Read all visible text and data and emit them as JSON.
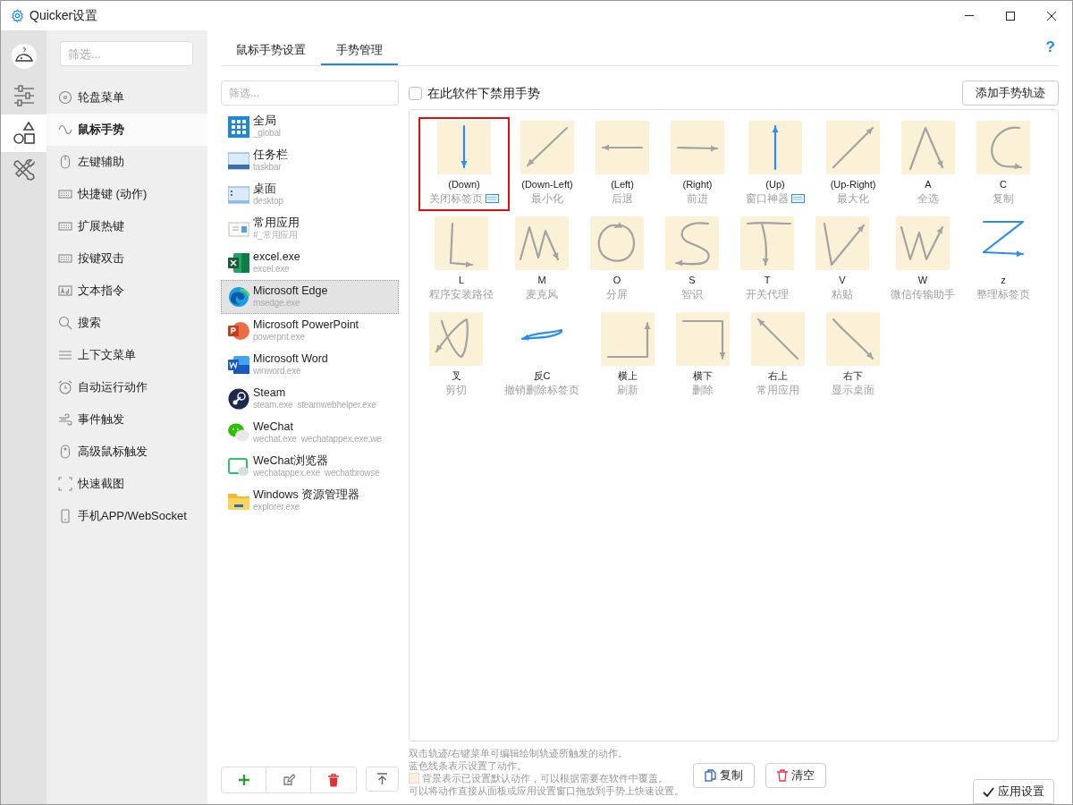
{
  "window": {
    "title": "Quicker设置"
  },
  "rail": [
    {
      "selected": false
    },
    {
      "selected": false
    },
    {
      "selected": true
    },
    {
      "selected": false
    }
  ],
  "nav": {
    "filter_placeholder": "筛选...",
    "items": [
      {
        "label": "轮盘菜单",
        "selected": false
      },
      {
        "label": "鼠标手势",
        "selected": true
      },
      {
        "label": "左键辅助",
        "selected": false
      },
      {
        "label": "快捷键 (动作)",
        "selected": false
      },
      {
        "label": "扩展热键",
        "selected": false
      },
      {
        "label": "按键双击",
        "selected": false
      },
      {
        "label": "文本指令",
        "selected": false
      },
      {
        "label": "搜索",
        "selected": false
      },
      {
        "label": "上下文菜单",
        "selected": false
      },
      {
        "label": "自动运行动作",
        "selected": false
      },
      {
        "label": "事件触发",
        "selected": false
      },
      {
        "label": "高级鼠标触发",
        "selected": false
      },
      {
        "label": "快速截图",
        "selected": false
      },
      {
        "label": "手机APP/WebSocket",
        "selected": false
      }
    ]
  },
  "tabs": [
    {
      "label": "鼠标手势设置",
      "selected": false
    },
    {
      "label": "手势管理",
      "selected": true
    }
  ],
  "help": "?",
  "apps": {
    "filter_placeholder": "筛选...",
    "items": [
      {
        "name": "全局",
        "exe": "_global",
        "selected": false
      },
      {
        "name": "任务栏",
        "exe": "taskbar",
        "selected": false
      },
      {
        "name": "桌面",
        "exe": "desktop",
        "selected": false
      },
      {
        "name": "常用应用",
        "exe": "#_常用应用",
        "selected": false
      },
      {
        "name": "excel.exe",
        "exe": "excel.exe",
        "selected": false
      },
      {
        "name": "Microsoft Edge",
        "exe": "msedge.exe",
        "selected": true
      },
      {
        "name": "Microsoft PowerPoint",
        "exe": "powerpnt.exe",
        "selected": false
      },
      {
        "name": "Microsoft Word",
        "exe": "winword.exe",
        "selected": false
      },
      {
        "name": "Steam",
        "exe": "steam.exe  steamwebhelper.exe",
        "selected": false
      },
      {
        "name": "WeChat",
        "exe": "wechat.exe  wechatappex.exe;we",
        "selected": false
      },
      {
        "name": "WeChat浏览器",
        "exe": "wechatappex.exe  wechatbrowse",
        "selected": false
      },
      {
        "name": "Windows 资源管理器",
        "exe": "explorer.exe",
        "selected": false
      }
    ]
  },
  "disable_gestures": {
    "label": "在此软件下禁用手势",
    "checked": false
  },
  "add_button": "添加手势轨迹",
  "gestures": [
    {
      "name": "(Down)",
      "action": "关闭标签页",
      "custom": true,
      "default": true,
      "hotkey": true,
      "selected": true
    },
    {
      "name": "(Down-Left)",
      "action": "最小化",
      "custom": false,
      "default": true,
      "hotkey": false,
      "selected": false
    },
    {
      "name": "(Left)",
      "action": "后退",
      "custom": false,
      "default": true,
      "hotkey": false,
      "selected": false
    },
    {
      "name": "(Right)",
      "action": "前进",
      "custom": false,
      "default": true,
      "hotkey": false,
      "selected": false
    },
    {
      "name": "(Up)",
      "action": "窗口神器",
      "custom": true,
      "default": true,
      "hotkey": true,
      "selected": false
    },
    {
      "name": "(Up-Right)",
      "action": "最大化",
      "custom": false,
      "default": true,
      "hotkey": false,
      "selected": false
    },
    {
      "name": "A",
      "action": "全选",
      "custom": false,
      "default": true,
      "hotkey": false,
      "selected": false
    },
    {
      "name": "C",
      "action": "复制",
      "custom": false,
      "default": true,
      "hotkey": false,
      "selected": false
    },
    {
      "name": "L",
      "action": "程序安装路径",
      "custom": false,
      "default": true,
      "hotkey": false,
      "selected": false
    },
    {
      "name": "M",
      "action": "麦克风",
      "custom": false,
      "default": true,
      "hotkey": false,
      "selected": false
    },
    {
      "name": "O",
      "action": "分屏",
      "custom": false,
      "default": true,
      "hotkey": false,
      "selected": false
    },
    {
      "name": "S",
      "action": "智识",
      "custom": false,
      "default": true,
      "hotkey": false,
      "selected": false
    },
    {
      "name": "T",
      "action": "开关代理",
      "custom": false,
      "default": true,
      "hotkey": false,
      "selected": false
    },
    {
      "name": "V",
      "action": "粘贴",
      "custom": false,
      "default": true,
      "hotkey": false,
      "selected": false
    },
    {
      "name": "W",
      "action": "微信传输助手",
      "custom": false,
      "default": true,
      "hotkey": false,
      "selected": false
    },
    {
      "name": "z",
      "action": "整理标签页",
      "custom": true,
      "default": false,
      "hotkey": false,
      "selected": false
    },
    {
      "name": "叉",
      "action": "剪切",
      "custom": false,
      "default": true,
      "hotkey": false,
      "selected": false
    },
    {
      "name": "反C",
      "action": "撤销删除标签页",
      "custom": true,
      "default": false,
      "hotkey": false,
      "selected": false
    },
    {
      "name": "横上",
      "action": "刷新",
      "custom": false,
      "default": true,
      "hotkey": false,
      "selected": false
    },
    {
      "name": "横下",
      "action": "删除",
      "custom": false,
      "default": true,
      "hotkey": false,
      "selected": false
    },
    {
      "name": "右上",
      "action": "常用应用",
      "custom": false,
      "default": true,
      "hotkey": false,
      "selected": false
    },
    {
      "name": "右下",
      "action": "显示桌面",
      "custom": false,
      "default": true,
      "hotkey": false,
      "selected": false
    }
  ],
  "notes": [
    "双击轨迹/右键菜单可编辑绘制轨迹所触发的动作。",
    "蓝色线条表示设置了动作。",
    "背景表示已设置默认动作，可以根据需要在软件中覆盖。",
    "可以将动作直接从面板或应用设置窗口拖放到手势上快速设置。"
  ],
  "copy_button": "复制",
  "clear_button": "清空",
  "apply_button": "应用设置"
}
